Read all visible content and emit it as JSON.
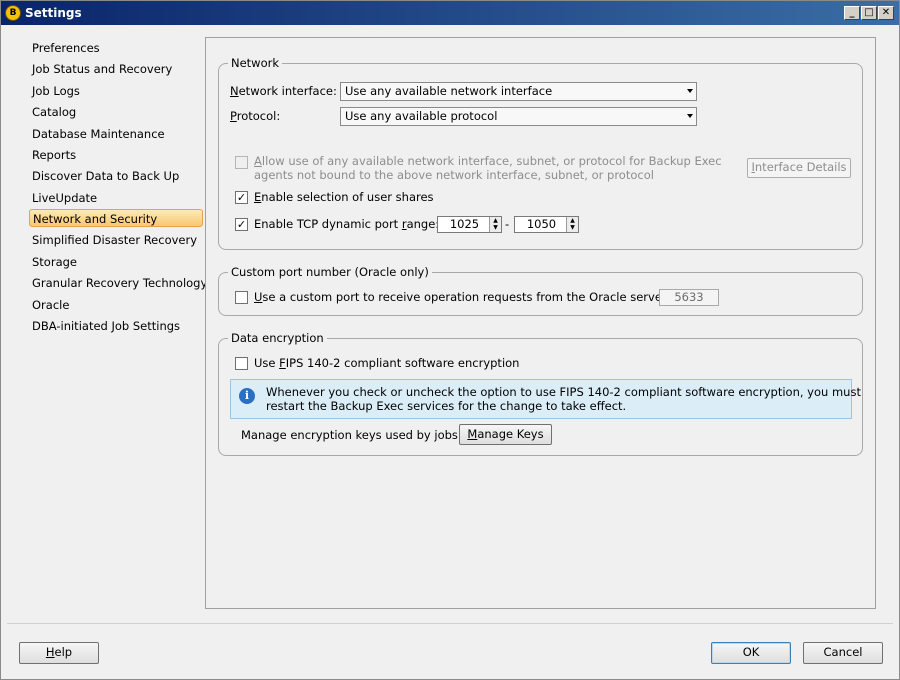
{
  "window": {
    "title": "Settings",
    "min_glyph": "_",
    "max_glyph": "□",
    "close_glyph": "✕",
    "app_icon_glyph": "B"
  },
  "sidebar": {
    "items": [
      {
        "label": "Preferences"
      },
      {
        "label": "Job Status and Recovery"
      },
      {
        "label": "Job Logs"
      },
      {
        "label": "Catalog"
      },
      {
        "label": "Database Maintenance"
      },
      {
        "label": "Reports"
      },
      {
        "label": "Discover Data to Back Up"
      },
      {
        "label": "LiveUpdate"
      },
      {
        "label": "Network and Security",
        "selected": true
      },
      {
        "label": "Simplified Disaster Recovery"
      },
      {
        "label": "Storage"
      },
      {
        "label": "Granular Recovery Technology"
      },
      {
        "label": "Oracle"
      },
      {
        "label": "DBA-initiated Job Settings"
      }
    ]
  },
  "network": {
    "group_title": "Network",
    "interface_label_u": "N",
    "interface_label_rest": "etwork interface:",
    "interface_value": "Use any available network interface",
    "protocol_label_u": "P",
    "protocol_label_rest": "rotocol:",
    "protocol_value": "Use any available protocol",
    "allow_any_line1_u": "A",
    "allow_any_line1_rest": "llow use of any available network interface, subnet, or protocol for Backup Exec",
    "allow_any_line2": "agents not bound to the above network interface, subnet, or protocol",
    "allow_any_checked": "",
    "interface_details_label_u": "I",
    "interface_details_label_rest": "nterface Details",
    "enable_shares_label_u": "E",
    "enable_shares_label_rest": "nable selection of user shares",
    "enable_shares_checked": "✓",
    "tcp_range_label_pre": "Enable TCP dynamic port ",
    "tcp_range_label_u": "r",
    "tcp_range_label_post": "ange:",
    "tcp_range_checked": "✓",
    "port_from": "1025",
    "port_sep": "-",
    "port_to": "1050",
    "spin_up": "▲",
    "spin_down": "▼"
  },
  "oracle_port": {
    "group_title": "Custom port number (Oracle only)",
    "checkbox_label_u": "U",
    "checkbox_label_rest": "se a custom port to receive operation requests from the Oracle server:",
    "checked": "",
    "port_value": "5633"
  },
  "encryption": {
    "group_title": "Data encryption",
    "fips_label_pre": "Use ",
    "fips_label_u": "F",
    "fips_label_post": "IPS 140-2 compliant software encryption",
    "fips_checked": "",
    "info_glyph": "i",
    "info_line1": "Whenever you check or uncheck the option to use FIPS 140-2 compliant software encryption, you must",
    "info_line2": "restart the Backup Exec services for the change to take effect.",
    "keys_label": "Manage encryption keys used by jobs:",
    "manage_keys_u": "M",
    "manage_keys_rest": "anage Keys"
  },
  "footer": {
    "help_u": "H",
    "help_rest": "elp",
    "ok_label": "OK",
    "cancel_label": "Cancel"
  }
}
